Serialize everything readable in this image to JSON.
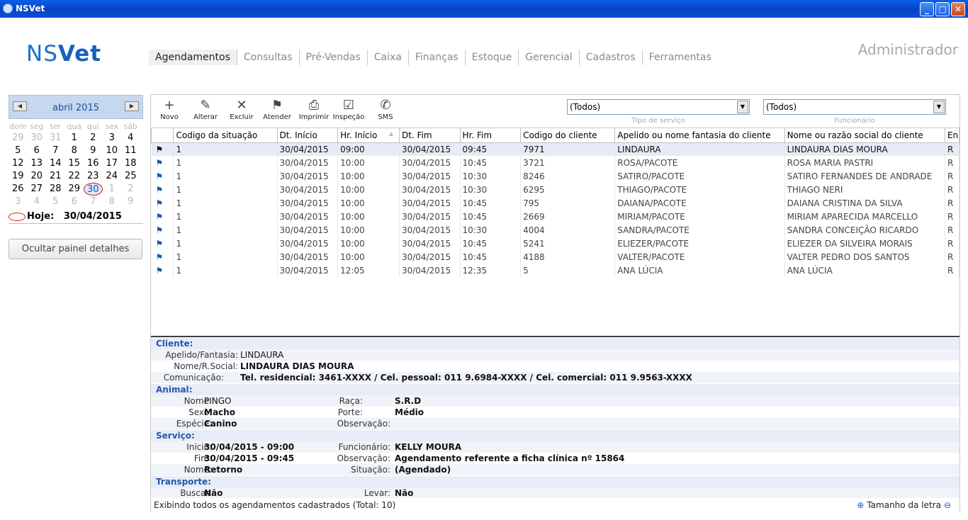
{
  "window": {
    "title": "NSVet"
  },
  "logo": {
    "ns": "NS",
    "vet": "Vet"
  },
  "menu": [
    "Agendamentos",
    "Consultas",
    "Pré-Vendas",
    "Caixa",
    "Finanças",
    "Estoque",
    "Gerencial",
    "Cadastros",
    "Ferramentas"
  ],
  "user": "Administrador",
  "calendar": {
    "month_label": "abril 2015",
    "weekdays": [
      "dom",
      "seg",
      "ter",
      "qua",
      "qui",
      "sex",
      "sáb"
    ],
    "weeks": [
      [
        [
          "29",
          1
        ],
        [
          "30",
          1
        ],
        [
          "31",
          1
        ],
        [
          "1",
          0
        ],
        [
          "2",
          0
        ],
        [
          "3",
          0
        ],
        [
          "4",
          0
        ]
      ],
      [
        [
          "5",
          0
        ],
        [
          "6",
          0
        ],
        [
          "7",
          0
        ],
        [
          "8",
          0
        ],
        [
          "9",
          0
        ],
        [
          "10",
          0
        ],
        [
          "11",
          0
        ]
      ],
      [
        [
          "12",
          0
        ],
        [
          "13",
          0
        ],
        [
          "14",
          0
        ],
        [
          "15",
          0
        ],
        [
          "16",
          0
        ],
        [
          "17",
          0
        ],
        [
          "18",
          0
        ]
      ],
      [
        [
          "19",
          0
        ],
        [
          "20",
          0
        ],
        [
          "21",
          0
        ],
        [
          "22",
          0
        ],
        [
          "23",
          0
        ],
        [
          "24",
          0
        ],
        [
          "25",
          0
        ]
      ],
      [
        [
          "26",
          0
        ],
        [
          "27",
          0
        ],
        [
          "28",
          0
        ],
        [
          "29",
          0
        ],
        [
          "30",
          2
        ],
        [
          "1",
          1
        ],
        [
          "2",
          1
        ]
      ],
      [
        [
          "3",
          1
        ],
        [
          "4",
          1
        ],
        [
          "5",
          1
        ],
        [
          "6",
          1
        ],
        [
          "7",
          1
        ],
        [
          "8",
          1
        ],
        [
          "9",
          1
        ]
      ]
    ],
    "today_label": "Hoje:",
    "today_value": "30/04/2015"
  },
  "hide_panel_label": "Ocultar painel detalhes",
  "toolbar": {
    "novo": "Novo",
    "alterar": "Alterar",
    "excluir": "Excluir",
    "atender": "Atender",
    "imprimir": "Imprimir",
    "inspecao": "Inspeção",
    "sms": "SMS"
  },
  "filters": {
    "servico": {
      "value": "(Todos)",
      "caption": "Tipo de serviço"
    },
    "funcionario": {
      "value": "(Todos)",
      "caption": "Funcionário"
    }
  },
  "table": {
    "columns": [
      "Codigo da situação",
      "Dt. Início",
      "Hr. Início",
      "Dt. Fim",
      "Hr. Fim",
      "Codigo do cliente",
      "Apelido ou nome fantasia do cliente",
      "Nome ou razão social do cliente",
      "En"
    ],
    "rows": [
      [
        "1",
        "30/04/2015",
        "09:00",
        "30/04/2015",
        "09:45",
        "7971",
        "LINDAURA",
        "LINDAURA DIAS MOURA",
        "R"
      ],
      [
        "1",
        "30/04/2015",
        "10:00",
        "30/04/2015",
        "10:45",
        "3721",
        "ROSA/PACOTE",
        "ROSA MARIA PASTRI",
        "R"
      ],
      [
        "1",
        "30/04/2015",
        "10:00",
        "30/04/2015",
        "10:30",
        "8246",
        "SATIRO/PACOTE",
        "SATIRO FERNANDES DE ANDRADE",
        "R"
      ],
      [
        "1",
        "30/04/2015",
        "10:00",
        "30/04/2015",
        "10:30",
        "6295",
        "THIAGO/PACOTE",
        "THIAGO NERI",
        "R"
      ],
      [
        "1",
        "30/04/2015",
        "10:00",
        "30/04/2015",
        "10:45",
        "795",
        "DAIANA/PACOTE",
        "DAIANA CRISTINA  DA SILVA",
        "R"
      ],
      [
        "1",
        "30/04/2015",
        "10:00",
        "30/04/2015",
        "10:45",
        "2669",
        "MIRIAM/PACOTE",
        "MIRIAM APARECIDA MARCELLO",
        "R"
      ],
      [
        "1",
        "30/04/2015",
        "10:00",
        "30/04/2015",
        "10:30",
        "4004",
        "SANDRA/PACOTE",
        "SANDRA CONCEIÇÃO RICARDO",
        "R"
      ],
      [
        "1",
        "30/04/2015",
        "10:00",
        "30/04/2015",
        "10:45",
        "5241",
        "ELIEZER/PACOTE",
        "ELIEZER DA SILVEIRA MORAIS",
        "R"
      ],
      [
        "1",
        "30/04/2015",
        "10:00",
        "30/04/2015",
        "10:45",
        "4188",
        "VALTER/PACOTE",
        "VALTER PEDRO DOS SANTOS",
        "R"
      ],
      [
        "1",
        "30/04/2015",
        "12:05",
        "30/04/2015",
        "12:35",
        "5",
        "ANA LÚCIA",
        "ANA LÚCIA",
        "R"
      ]
    ]
  },
  "details": {
    "cliente": {
      "title": "Cliente:",
      "apelido_l": "Apelido/Fantasia:",
      "apelido_v": "LINDAURA",
      "nome_l": "Nome/R.Social:",
      "nome_v": "LINDAURA DIAS MOURA",
      "com_l": "Comunicação:",
      "com_v": "Tel. residencial: 3461-XXXX  / Cel. pessoal: 011 9.6984-XXXX  / Cel. comercial: 011 9.9563-XXXX"
    },
    "animal": {
      "title": "Animal:",
      "nome_l": "Nome:",
      "nome_v": "PINGO",
      "raca_l": "Raça:",
      "raca_v": "S.R.D",
      "sexo_l": "Sexo:",
      "sexo_v": "Macho",
      "porte_l": "Porte:",
      "porte_v": "Médio",
      "especie_l": "Espécie:",
      "especie_v": "Canino",
      "obs_l": "Observação:",
      "obs_v": ""
    },
    "servico": {
      "title": "Serviço:",
      "inicio_l": "Inicio:",
      "inicio_v": "30/04/2015 - 09:00",
      "func_l": "Funcionário:",
      "func_v": "KELLY MOURA",
      "fim_l": "Fim:",
      "fim_v": "30/04/2015 - 09:45",
      "obs_l": "Observação:",
      "obs_v": "Agendamento referente a ficha clínica nº 15864",
      "nome_l": "Nome:",
      "nome_v": "Retorno",
      "sit_l": "Situação:",
      "sit_v": "(Agendado)"
    },
    "transporte": {
      "title": "Transporte:",
      "buscar_l": "Buscar:",
      "buscar_v": "Não",
      "levar_l": "Levar:",
      "levar_v": "Não"
    }
  },
  "status": {
    "text": "Exibindo todos os agendamentos cadastrados (Total: 10)",
    "font_size_label": "Tamanho da letra"
  }
}
